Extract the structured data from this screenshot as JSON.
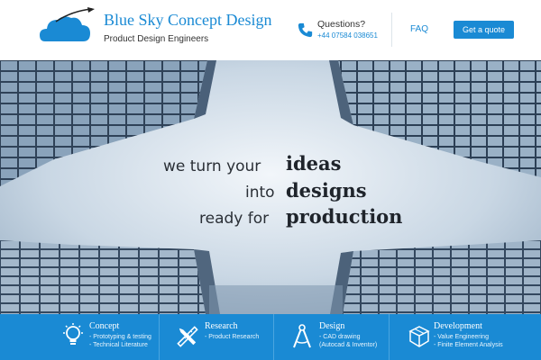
{
  "header": {
    "brand_title": "Blue Sky Concept Design",
    "brand_subtitle": "Product Design Engineers",
    "questions_label": "Questions?",
    "phone": "+44 07584 038651",
    "faq_label": "FAQ",
    "quote_label": "Get a quote"
  },
  "hero": {
    "lines": [
      {
        "light": "we turn your",
        "bold": "ideas"
      },
      {
        "light": "into",
        "bold": "designs"
      },
      {
        "light": "ready for",
        "bold": "production"
      }
    ]
  },
  "services": [
    {
      "title": "Concept",
      "icon": "lightbulb-icon",
      "items": [
        "- Prototyping & testing",
        "- Technical Literature"
      ]
    },
    {
      "title": "Research",
      "icon": "tools-icon",
      "items": [
        "- Product Research"
      ]
    },
    {
      "title": "Design",
      "icon": "compass-icon",
      "items": [
        "- CAD drawing",
        "(Autocad & Inventor)"
      ]
    },
    {
      "title": "Development",
      "icon": "cube-icon",
      "items": [
        "- Value Engineering",
        "- Finite Element Analysis"
      ]
    }
  ],
  "colors": {
    "accent": "#1a8ad4",
    "services_bg": "#1a8ad4",
    "tagline_text": "#2a2f36"
  }
}
